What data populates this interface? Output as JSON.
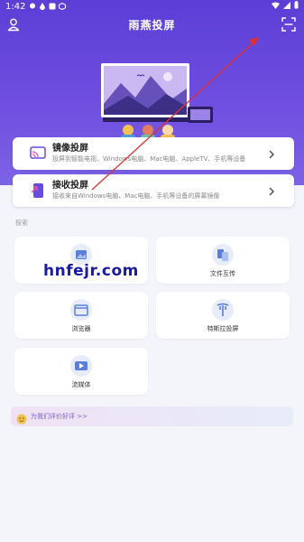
{
  "status_bar": {
    "time": "1:42"
  },
  "header": {
    "title": "雨燕投屏"
  },
  "cards": [
    {
      "title": "镜像投屏",
      "desc": "投屏到智能电视、Windows电脑、Mac电脑、AppleTV、手机等设备"
    },
    {
      "title": "接收投屏",
      "desc": "接收来自Windows电脑、Mac电脑、手机等设备的屏幕镜像"
    }
  ],
  "explore": {
    "label": "探索",
    "tiles": [
      {
        "label": "",
        "icon": "image-icon"
      },
      {
        "label": "文件互传",
        "icon": "file-transfer-icon"
      },
      {
        "label": "浏览器",
        "icon": "browser-icon"
      },
      {
        "label": "特斯拉投屏",
        "icon": "tesla-icon"
      },
      {
        "label": "流媒体",
        "icon": "streaming-icon"
      }
    ]
  },
  "watermark": "hnfejr.com",
  "promo": {
    "text": "为我们评价好评 >>"
  },
  "colors": {
    "accent": "#6a4be0",
    "arrow": "#e03030"
  }
}
